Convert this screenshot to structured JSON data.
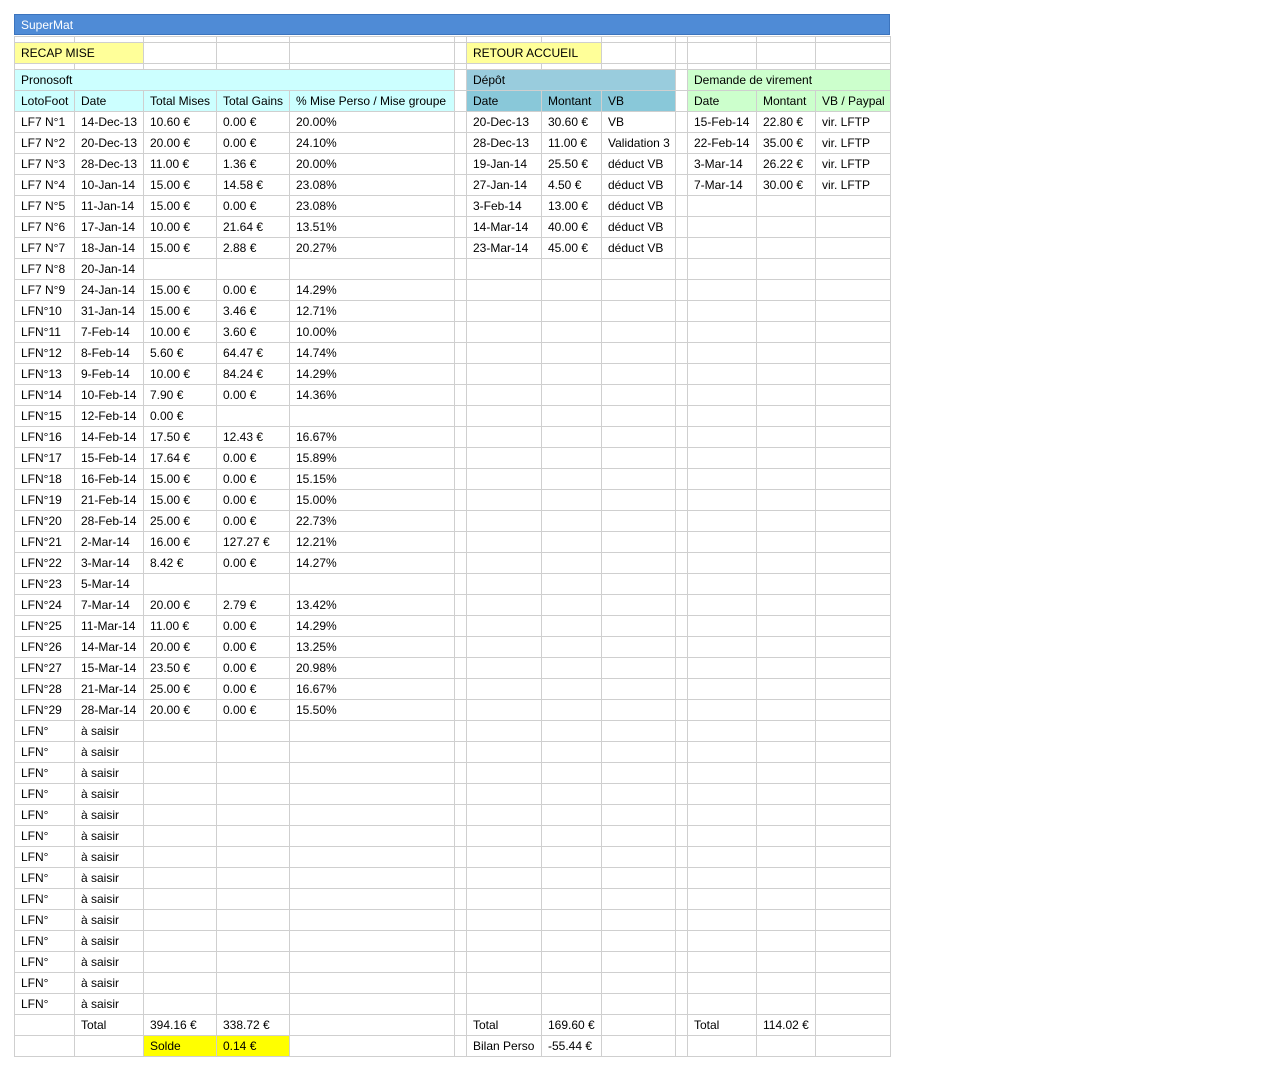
{
  "window": {
    "title": "SuperMat"
  },
  "nav": {
    "recap_label": "RECAP MISE",
    "retour_label": "RETOUR ACCUEIL"
  },
  "sections": {
    "pronosoft": "Pronosoft",
    "depot": "Dépôt",
    "virement": "Demande de virement"
  },
  "pronosoft_headers": [
    "LotoFoot",
    "Date",
    "Total Mises",
    "Total Gains",
    "% Mise Perso / Mise groupe"
  ],
  "depot_headers": [
    "Date",
    "Montant",
    "VB"
  ],
  "virement_headers": [
    "Date",
    "Montant",
    "VB / Paypal"
  ],
  "pronosoft_rows": [
    [
      "LF7 N°1",
      "14-Dec-13",
      "10.60 €",
      "0.00 €",
      "20.00%"
    ],
    [
      "LF7 N°2",
      "20-Dec-13",
      "20.00 €",
      "0.00 €",
      "24.10%"
    ],
    [
      "LF7 N°3",
      "28-Dec-13",
      "11.00 €",
      "1.36 €",
      "20.00%"
    ],
    [
      "LF7 N°4",
      "10-Jan-14",
      "15.00 €",
      "14.58 €",
      "23.08%"
    ],
    [
      "LF7 N°5",
      "11-Jan-14",
      "15.00 €",
      "0.00 €",
      "23.08%"
    ],
    [
      "LF7 N°6",
      "17-Jan-14",
      "10.00 €",
      "21.64 €",
      "13.51%"
    ],
    [
      "LF7 N°7",
      "18-Jan-14",
      "15.00 €",
      "2.88 €",
      "20.27%"
    ],
    [
      "LF7 N°8",
      "20-Jan-14",
      "",
      "",
      ""
    ],
    [
      "LF7 N°9",
      "24-Jan-14",
      "15.00 €",
      "0.00 €",
      "14.29%"
    ],
    [
      "LFN°10",
      "31-Jan-14",
      "15.00 €",
      "3.46 €",
      "12.71%"
    ],
    [
      "LFN°11",
      "7-Feb-14",
      "10.00 €",
      "3.60 €",
      "10.00%"
    ],
    [
      "LFN°12",
      "8-Feb-14",
      "5.60 €",
      "64.47 €",
      "14.74%"
    ],
    [
      "LFN°13",
      "9-Feb-14",
      "10.00 €",
      "84.24 €",
      "14.29%"
    ],
    [
      "LFN°14",
      "10-Feb-14",
      "7.90 €",
      "0.00 €",
      "14.36%"
    ],
    [
      "LFN°15",
      "12-Feb-14",
      "0.00 €",
      "",
      ""
    ],
    [
      "LFN°16",
      "14-Feb-14",
      "17.50 €",
      "12.43 €",
      "16.67%"
    ],
    [
      "LFN°17",
      "15-Feb-14",
      "17.64 €",
      "0.00 €",
      "15.89%"
    ],
    [
      "LFN°18",
      "16-Feb-14",
      "15.00 €",
      "0.00 €",
      "15.15%"
    ],
    [
      "LFN°19",
      "21-Feb-14",
      "15.00 €",
      "0.00 €",
      "15.00%"
    ],
    [
      "LFN°20",
      "28-Feb-14",
      "25.00 €",
      "0.00 €",
      "22.73%"
    ],
    [
      "LFN°21",
      "2-Mar-14",
      "16.00 €",
      "127.27 €",
      "12.21%"
    ],
    [
      "LFN°22",
      "3-Mar-14",
      "8.42 €",
      "0.00 €",
      "14.27%"
    ],
    [
      "LFN°23",
      "5-Mar-14",
      "",
      "",
      ""
    ],
    [
      "LFN°24",
      "7-Mar-14",
      "20.00 €",
      "2.79 €",
      "13.42%"
    ],
    [
      "LFN°25",
      "11-Mar-14",
      "11.00 €",
      "0.00 €",
      "14.29%"
    ],
    [
      "LFN°26",
      "14-Mar-14",
      "20.00 €",
      "0.00 €",
      "13.25%"
    ],
    [
      "LFN°27",
      "15-Mar-14",
      "23.50 €",
      "0.00 €",
      "20.98%"
    ],
    [
      "LFN°28",
      "21-Mar-14",
      "25.00 €",
      "0.00 €",
      "16.67%"
    ],
    [
      "LFN°29",
      "28-Mar-14",
      "20.00 €",
      "0.00 €",
      "15.50%"
    ],
    [
      "LFN°",
      "à saisir",
      "",
      "",
      ""
    ],
    [
      "LFN°",
      "à saisir",
      "",
      "",
      ""
    ],
    [
      "LFN°",
      "à saisir",
      "",
      "",
      ""
    ],
    [
      "LFN°",
      "à saisir",
      "",
      "",
      ""
    ],
    [
      "LFN°",
      "à saisir",
      "",
      "",
      ""
    ],
    [
      "LFN°",
      "à saisir",
      "",
      "",
      ""
    ],
    [
      "LFN°",
      "à saisir",
      "",
      "",
      ""
    ],
    [
      "LFN°",
      "à saisir",
      "",
      "",
      ""
    ],
    [
      "LFN°",
      "à saisir",
      "",
      "",
      ""
    ],
    [
      "LFN°",
      "à saisir",
      "",
      "",
      ""
    ],
    [
      "LFN°",
      "à saisir",
      "",
      "",
      ""
    ],
    [
      "LFN°",
      "à saisir",
      "",
      "",
      ""
    ],
    [
      "LFN°",
      "à saisir",
      "",
      "",
      ""
    ],
    [
      "LFN°",
      "à saisir",
      "",
      "",
      ""
    ]
  ],
  "depot_rows": [
    [
      "20-Dec-13",
      "30.60 €",
      "VB"
    ],
    [
      "28-Dec-13",
      "11.00 €",
      "Validation 3"
    ],
    [
      "19-Jan-14",
      "25.50 €",
      "déduct VB"
    ],
    [
      "27-Jan-14",
      "4.50 €",
      "déduct VB"
    ],
    [
      "3-Feb-14",
      "13.00 €",
      "déduct VB"
    ],
    [
      "14-Mar-14",
      "40.00 €",
      "déduct VB"
    ],
    [
      "23-Mar-14",
      "45.00 €",
      "déduct VB"
    ]
  ],
  "virement_rows": [
    [
      "15-Feb-14",
      "22.80 €",
      "vir. LFTP"
    ],
    [
      "22-Feb-14",
      "35.00 €",
      "vir. LFTP"
    ],
    [
      "3-Mar-14",
      "26.22 €",
      "vir. LFTP"
    ],
    [
      "7-Mar-14",
      "30.00 €",
      "vir. LFTP"
    ]
  ],
  "totals": {
    "pronosoft_label": "Total",
    "total_mises": "394.16 €",
    "total_gains": "338.72 €",
    "solde_label": "Solde",
    "solde_value": "0.14 €",
    "depot_label": "Total",
    "depot_total": "169.60 €",
    "bilan_label": "Bilan Perso",
    "bilan_value": "-55.44 €",
    "virement_label": "Total",
    "virement_total": "114.02 €"
  }
}
